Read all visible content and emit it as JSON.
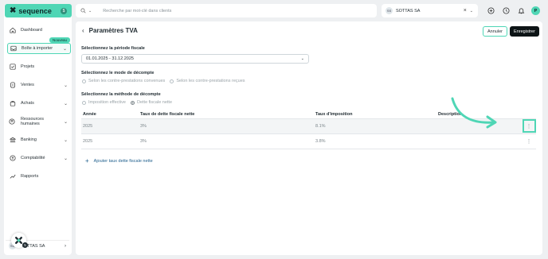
{
  "brand": {
    "name": "sequence",
    "badge": "$"
  },
  "sidebar": {
    "badge_new": "Nouveau",
    "items": [
      {
        "label": "Dashboard",
        "icon": "home-icon",
        "chevron": false
      },
      {
        "label": "Boîte à importer",
        "icon": "inbox-icon",
        "chevron": true,
        "active": true
      },
      {
        "label": "Projets",
        "icon": "check-square-icon",
        "chevron": false
      },
      {
        "label": "Ventes",
        "icon": "coin-icon",
        "chevron": true
      },
      {
        "label": "Achats",
        "icon": "bag-icon",
        "chevron": true
      },
      {
        "label": "Ressources humaines",
        "icon": "people-icon",
        "chevron": true
      },
      {
        "label": "Banking",
        "icon": "bank-icon",
        "chevron": true
      },
      {
        "label": "Comptabilité",
        "icon": "calculator-icon",
        "chevron": true
      },
      {
        "label": "Rapports",
        "icon": "chart-icon",
        "chevron": false
      }
    ],
    "footer_company": "SOTTAS SA",
    "footer_avatar": "SS",
    "floating_badge": "5"
  },
  "topbar": {
    "search_placeholder": "Recherche par mot-clé dans clients",
    "company": "SOTTAS SA",
    "company_avatar": "SS",
    "user_initial": "P"
  },
  "page": {
    "title": "Paramètres TVA",
    "cancel": "Annuler",
    "save": "Enregistrer",
    "period_label": "Sélectionnez la période fiscale",
    "period_value": "01.01.2025 - 31.12.2025",
    "mode_label": "Sélectionnez le mode de décompte",
    "mode_options": [
      "Selon les contre-prestations convenues",
      "Selon les contre-prestations reçues"
    ],
    "method_label": "Sélectionnez la méthode de décompte",
    "method_options": [
      "Imposition effective",
      "Dette fiscale nette"
    ],
    "table": {
      "headers": [
        "Année",
        "Taux de dette fiscale nette",
        "Taux d'imposition",
        "Description"
      ],
      "rows": [
        [
          "2025",
          "3%",
          "8.1%",
          ""
        ],
        [
          "2025",
          "3%",
          "3.8%",
          ""
        ]
      ]
    },
    "add_rate": "Ajouter taux dette fiscale nette"
  },
  "colors": {
    "accent": "#4fd6b5",
    "dark": "#0d1416",
    "link": "#1e5e8c"
  }
}
